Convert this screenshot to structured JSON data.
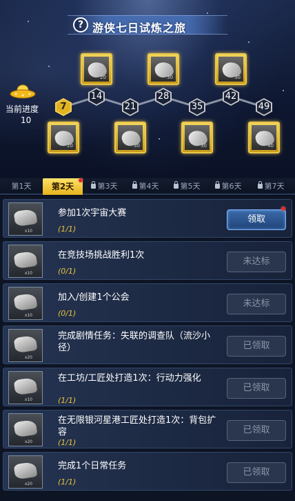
{
  "header": {
    "title": "游侠七日试炼之旅",
    "help_icon": "question-circle-icon"
  },
  "progress": {
    "label": "当前进度",
    "value": "10",
    "icon": "ufo-icon",
    "current_milestone": 7,
    "milestones": [
      {
        "value": "7",
        "active": true
      },
      {
        "value": "14",
        "active": false
      },
      {
        "value": "21",
        "active": false
      },
      {
        "value": "28",
        "active": false
      },
      {
        "value": "35",
        "active": false
      },
      {
        "value": "42",
        "active": false
      },
      {
        "value": "49",
        "active": false
      }
    ],
    "chests": [
      {
        "qty": "20"
      },
      {
        "qty": "20"
      },
      {
        "qty": "30"
      },
      {
        "qty": "30"
      },
      {
        "qty": "30"
      },
      {
        "qty": "30"
      },
      {
        "qty": "40"
      }
    ],
    "accent_color": "#f3d15a"
  },
  "tabs": [
    {
      "label": "第1天",
      "selected": false,
      "locked": false
    },
    {
      "label": "第2天",
      "selected": true,
      "locked": false,
      "badge": true
    },
    {
      "label": "第3天",
      "selected": false,
      "locked": true
    },
    {
      "label": "第4天",
      "selected": false,
      "locked": true
    },
    {
      "label": "第5天",
      "selected": false,
      "locked": true
    },
    {
      "label": "第6天",
      "selected": false,
      "locked": true
    },
    {
      "label": "第7天",
      "selected": false,
      "locked": true
    }
  ],
  "tasks": [
    {
      "name": "参加1次宇宙大赛",
      "progress": "(1/1)",
      "qty": "x10",
      "button": "领取",
      "state": "claim",
      "badge": true
    },
    {
      "name": "在竞技场挑战胜利1次",
      "progress": "(0/1)",
      "qty": "x10",
      "button": "未达标",
      "state": "disabled"
    },
    {
      "name": "加入/创建1个公会",
      "progress": "(0/1)",
      "qty": "x10",
      "button": "未达标",
      "state": "disabled"
    },
    {
      "name": "完成剧情任务：失联的调查队（流沙小径）",
      "progress": "",
      "qty": "x20",
      "button": "已领取",
      "state": "disabled"
    },
    {
      "name": "在工坊/工匠处打造1次：行动力强化",
      "progress": "(1/1)",
      "qty": "x10",
      "button": "已领取",
      "state": "disabled"
    },
    {
      "name": "在无限银河星港工匠处打造1次：背包扩容",
      "progress": "(1/1)",
      "qty": "x20",
      "button": "已领取",
      "state": "disabled"
    },
    {
      "name": "完成1个日常任务",
      "progress": "(1/1)",
      "qty": "x20",
      "button": "已领取",
      "state": "disabled"
    }
  ]
}
